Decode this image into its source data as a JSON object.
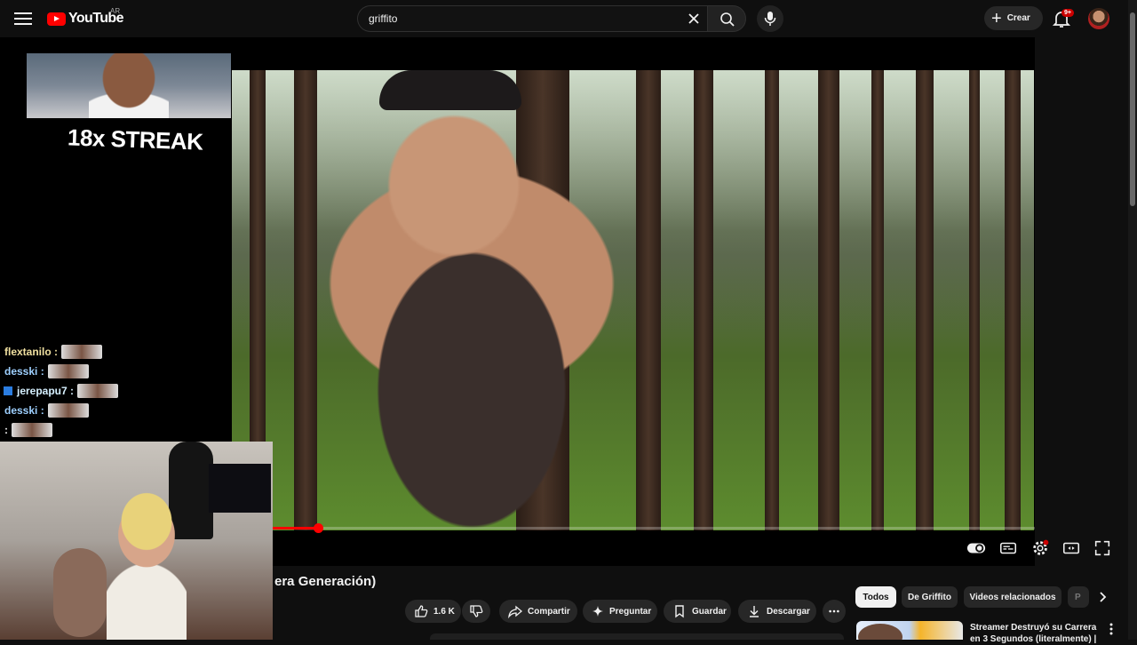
{
  "app": {
    "logo_text": "YouTube",
    "country_code": "AR"
  },
  "header": {
    "search_value": "griffito",
    "create_label": "Crear",
    "notification_count": "9+"
  },
  "stream_overlay": {
    "streak_text": "18x STREAK",
    "chat": [
      {
        "name": "flextanilo :",
        "color": "#f0e0a0"
      },
      {
        "name": "desski :",
        "color": "#9ed0ff"
      },
      {
        "name": "jerepapu7 :",
        "color": "#d6f0ff"
      },
      {
        "name": "desski :",
        "color": "#9ed0ff"
      },
      {
        "name": ":",
        "color": "#f1f1f1"
      }
    ]
  },
  "player": {
    "progress": 0.06
  },
  "video": {
    "title": "era Generación)",
    "like_count": "1.6 K",
    "actions": {
      "share": "Compartir",
      "ask": "Preguntar",
      "save": "Guardar",
      "download": "Descargar"
    }
  },
  "related": {
    "chips": [
      "Todos",
      "De Griffito",
      "Videos relacionados",
      "P"
    ],
    "first_video_title": "Streamer Destruyó su Carrera en 3 Segundos (literalmente) |"
  },
  "colors": {
    "background": "#0f0f0f",
    "accent": "#ff0000",
    "pill": "#272727"
  }
}
